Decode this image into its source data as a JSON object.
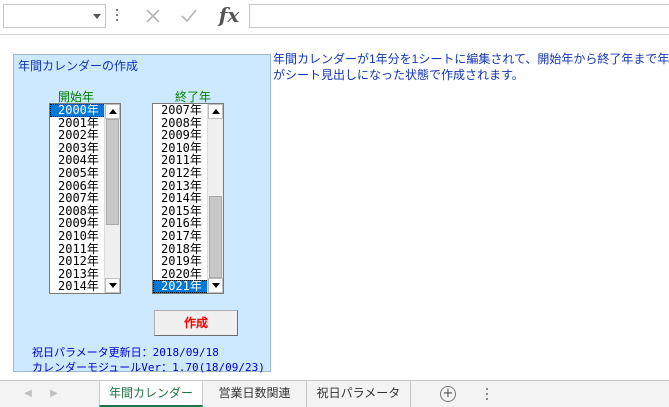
{
  "formula_bar": {
    "name_box_value": "",
    "formula_value": "",
    "cancel_icon": "close-icon",
    "enter_icon": "check-icon",
    "function_label": "fx"
  },
  "panel": {
    "title": "年間カレンダーの作成",
    "start_label": "開始年",
    "end_label": "終了年",
    "start_list": [
      "2000年",
      "2001年",
      "2002年",
      "2003年",
      "2004年",
      "2005年",
      "2006年",
      "2007年",
      "2008年",
      "2009年",
      "2010年",
      "2011年",
      "2012年",
      "2013年",
      "2014年"
    ],
    "start_selected": "2000年",
    "end_list": [
      "2007年",
      "2008年",
      "2009年",
      "2010年",
      "2011年",
      "2012年",
      "2013年",
      "2014年",
      "2015年",
      "2016年",
      "2017年",
      "2018年",
      "2019年",
      "2020年",
      "2021年"
    ],
    "end_selected": "2021年",
    "create_button": "作成",
    "holiday_param_date": "祝日パラメータ更新日：2018/09/18",
    "module_version": "カレンダーモジュールVer：1.70(18/09/23)"
  },
  "description": {
    "line1": "年間カレンダーが1年分を1シートに編集されて、開始年から終了年まで年",
    "line2": "がシート見出しになった状態で作成されます。"
  },
  "tabs": [
    {
      "label": "年間カレンダー",
      "active": true
    },
    {
      "label": "営業日数関連",
      "active": false
    },
    {
      "label": "祝日パラメータ",
      "active": false
    }
  ],
  "colors": {
    "panel_bg": "#cce9ff",
    "title_text": "#1234b8",
    "label_green": "#008000",
    "button_red": "#ff0000",
    "selection": "#0078d7",
    "active_tab": "#217346"
  }
}
